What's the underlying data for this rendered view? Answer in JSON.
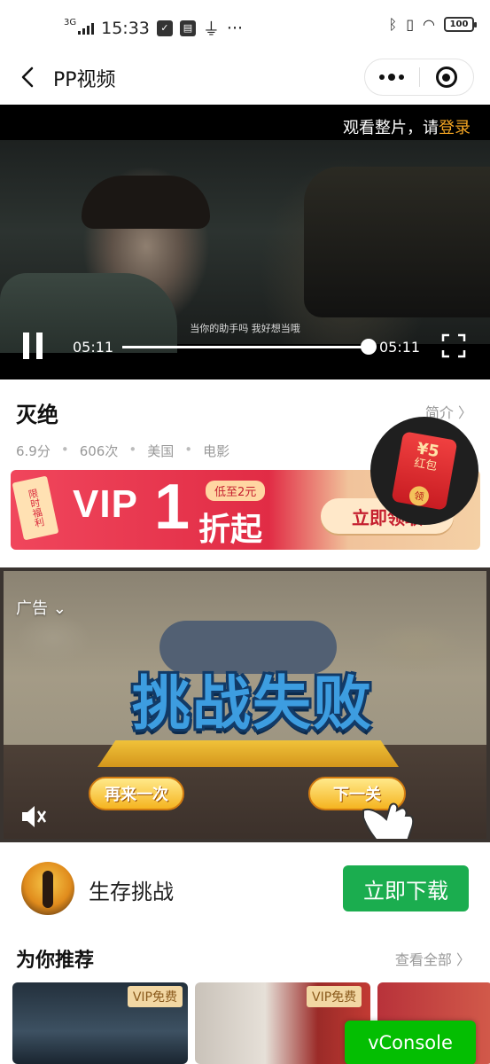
{
  "status_bar": {
    "network": "3G",
    "time": "15:33",
    "dots": "···",
    "battery": "100"
  },
  "nav": {
    "title": "PP视频",
    "icons": [
      "back-chevron-icon",
      "more-dots-icon",
      "mini-program-close-icon"
    ]
  },
  "player": {
    "login_prefix": "观看整片，请",
    "login_link": "登录",
    "subtitle": "当你的助手吗  我好想当哦",
    "current_time": "05:11",
    "duration": "05:11",
    "progress": 1.0
  },
  "movie": {
    "title": "灭绝",
    "intro_link": "简介 〉",
    "score": "6.9分",
    "plays": "606次",
    "region": "美国",
    "category": "电影",
    "separator": "•"
  },
  "vip_banner": {
    "tag": "限时福利",
    "vip": "VIP",
    "number": "1",
    "pill": "低至2元",
    "suffix": "折起",
    "cta": "立即领取"
  },
  "red_packet": {
    "amount": "¥5",
    "label_line1": "红包",
    "seal": "领"
  },
  "ad": {
    "label": "广告 ⌄",
    "headline": "挑战失败",
    "retry": "再来一次",
    "next": "下一关",
    "progress": 0.64
  },
  "app_row": {
    "name": "生存挑战",
    "download": "立即下载"
  },
  "recommend": {
    "title": "为你推荐",
    "more": "查看全部 〉",
    "badge": "VIP免费"
  },
  "vconsole": "vConsole",
  "colors": {
    "accent_green": "#1bad4f",
    "login_orange": "#f5a623",
    "vip_red": "#e12c45"
  }
}
